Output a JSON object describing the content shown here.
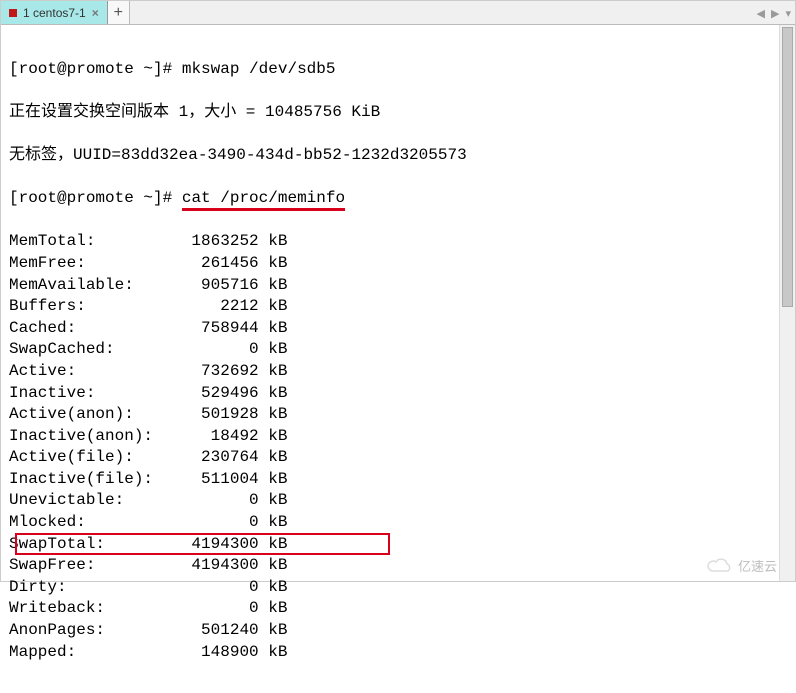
{
  "tab": {
    "label": "1 centos7-1",
    "close": "×"
  },
  "newtab": "+",
  "nav": {
    "left": "◀",
    "right": "▶",
    "menu": "▾"
  },
  "prompt1_user": "[root@promote ~]#",
  "cmd1": "mkswap /dev/sdb5",
  "out1": "正在设置交换空间版本 1，大小 = 10485756 KiB",
  "out2": "无标签，UUID=83dd32ea-3490-434d-bb52-1232d3205573",
  "prompt2_user": "[root@promote ~]#",
  "cmd2": "cat /proc/meminfo",
  "mem": [
    {
      "k": "MemTotal:",
      "v": "1863252",
      "u": "kB"
    },
    {
      "k": "MemFree:",
      "v": "261456",
      "u": "kB"
    },
    {
      "k": "MemAvailable:",
      "v": "905716",
      "u": "kB"
    },
    {
      "k": "Buffers:",
      "v": "2212",
      "u": "kB"
    },
    {
      "k": "Cached:",
      "v": "758944",
      "u": "kB"
    },
    {
      "k": "SwapCached:",
      "v": "0",
      "u": "kB"
    },
    {
      "k": "Active:",
      "v": "732692",
      "u": "kB"
    },
    {
      "k": "Inactive:",
      "v": "529496",
      "u": "kB"
    },
    {
      "k": "Active(anon):",
      "v": "501928",
      "u": "kB"
    },
    {
      "k": "Inactive(anon):",
      "v": "18492",
      "u": "kB"
    },
    {
      "k": "Active(file):",
      "v": "230764",
      "u": "kB"
    },
    {
      "k": "Inactive(file):",
      "v": "511004",
      "u": "kB"
    },
    {
      "k": "Unevictable:",
      "v": "0",
      "u": "kB"
    },
    {
      "k": "Mlocked:",
      "v": "0",
      "u": "kB"
    },
    {
      "k": "SwapTotal:",
      "v": "4194300",
      "u": "kB",
      "boxed": true
    },
    {
      "k": "SwapFree:",
      "v": "4194300",
      "u": "kB"
    },
    {
      "k": "Dirty:",
      "v": "0",
      "u": "kB"
    },
    {
      "k": "Writeback:",
      "v": "0",
      "u": "kB"
    },
    {
      "k": "AnonPages:",
      "v": "501240",
      "u": "kB"
    },
    {
      "k": "Mapped:",
      "v": "148900",
      "u": "kB"
    }
  ],
  "watermark": "亿速云"
}
